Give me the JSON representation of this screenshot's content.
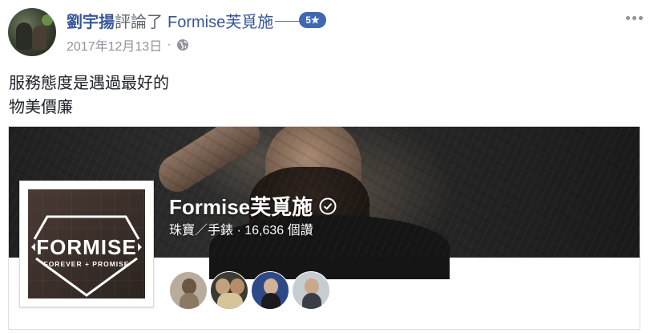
{
  "post": {
    "author": "劉宇揚",
    "action": "評論了",
    "page_link": "Formise芙覓施",
    "rating": "5★",
    "date": "2017年12月13日",
    "separator": "·",
    "privacy_icon": "globe-icon",
    "more_icon": "more-options-icon",
    "review_lines": [
      "服務態度是遇過最好的",
      "物美價廉"
    ]
  },
  "page_card": {
    "name": "Formise芙覓施",
    "verified_icon": "verified-check-icon",
    "category_and_likes": "珠寶／手錶 · 16,636 個讚",
    "logo": {
      "brand": "FORMISE",
      "tagline": "FOREVER + PROMISE"
    },
    "friend_avatars": [
      "friend-avatar-1",
      "friend-avatar-2",
      "friend-avatar-3",
      "friend-avatar-4"
    ]
  },
  "colors": {
    "link_blue": "#365899",
    "rating_badge": "#4267b2",
    "meta_gray": "#90949c",
    "text": "#1d2129",
    "border": "#dddfe2"
  }
}
